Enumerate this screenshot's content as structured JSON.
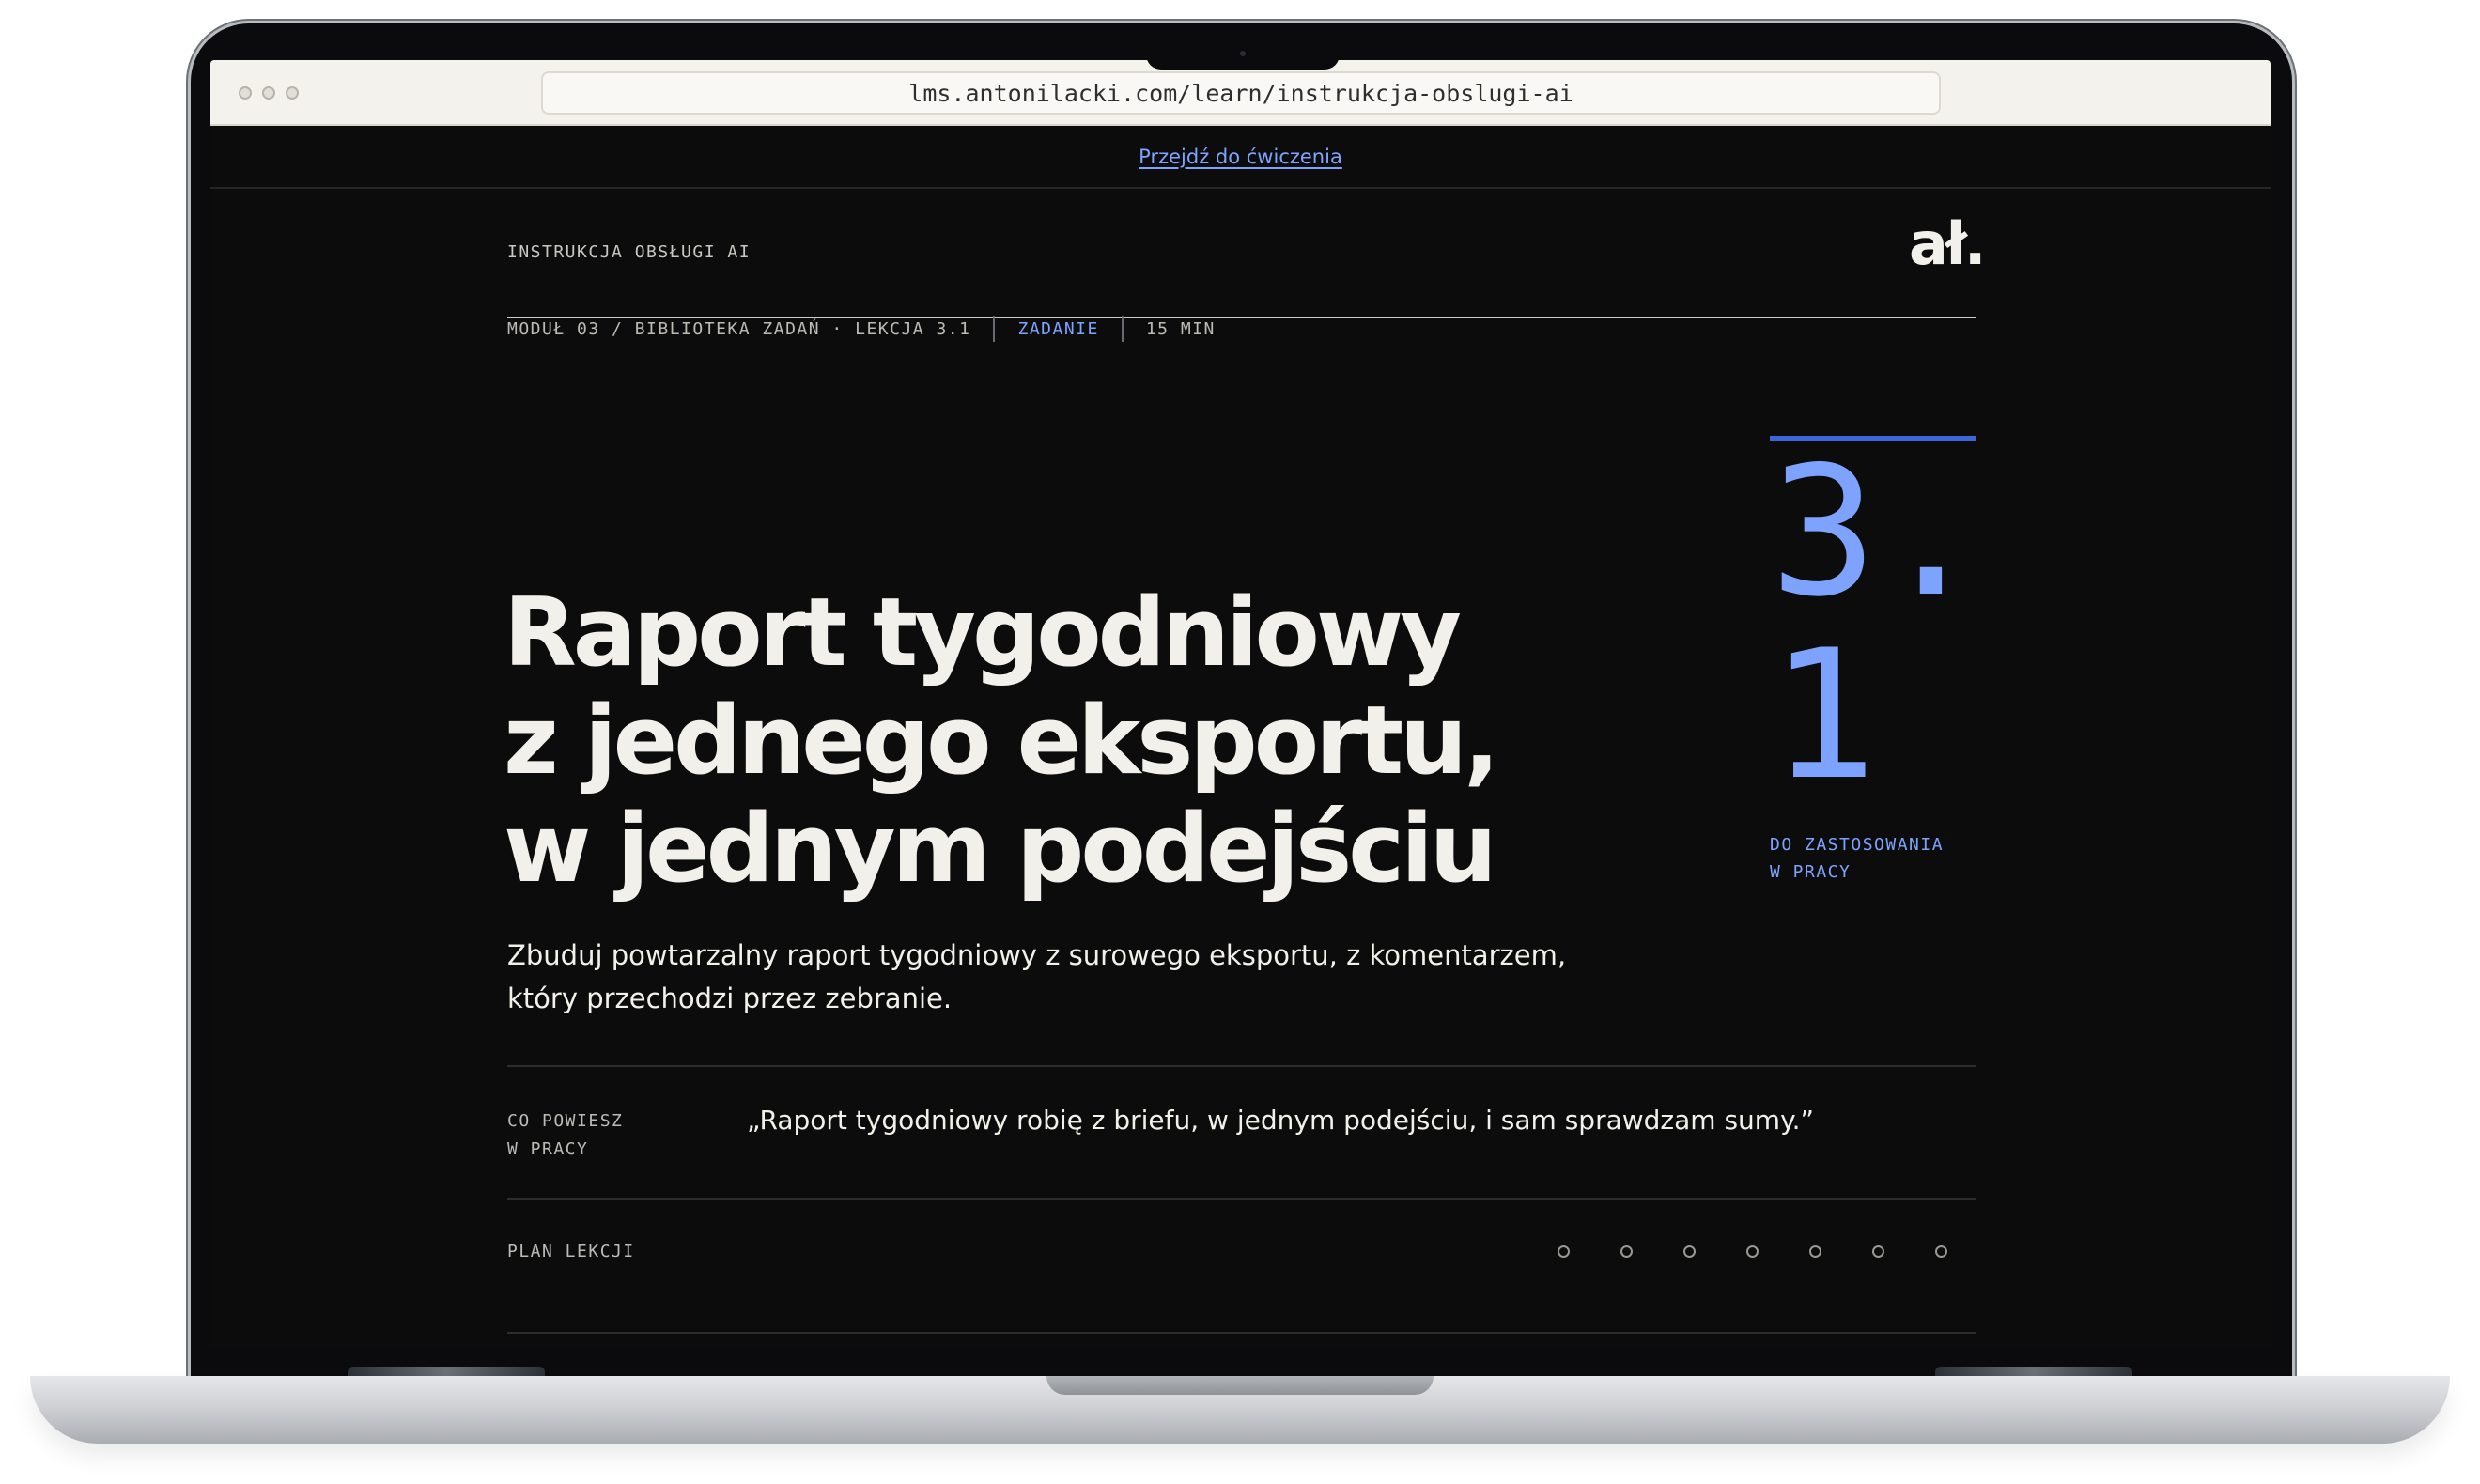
{
  "browser": {
    "url": "lms.antonilacki.com/learn/instrukcja-obslugi-ai"
  },
  "skip_link": "Przejdź do ćwiczenia",
  "header": {
    "eyebrow": "INSTRUKCJA OBSŁUGI AI",
    "logo": "ał."
  },
  "meta": {
    "breadcrumb": "MODUŁ 03 / BIBLIOTEKA ZADAŃ · LEKCJA 3.1",
    "type": "ZADANIE",
    "duration": "15 MIN"
  },
  "lesson": {
    "number_line1": "3.",
    "number_line2": "1",
    "note_line1": "DO ZASTOSOWANIA",
    "note_line2": "W PRACY",
    "title_line1": "Raport tygodniowy",
    "title_line2": "z jednego eksportu,",
    "title_line3": "w jednym podejściu",
    "lede_line1": "Zbuduj powtarzalny raport tygodniowy z surowego eksportu, z komentarzem,",
    "lede_line2": "który przechodzi przez zebranie."
  },
  "say": {
    "label_line1": "CO POWIESZ",
    "label_line2": "W PRACY",
    "quote": "„Raport tygodniowy robię z briefu, w jednym podejściu, i sam sprawdzam sumy.”"
  },
  "plan": {
    "label": "PLAN LEKCJI",
    "steps": 7
  }
}
